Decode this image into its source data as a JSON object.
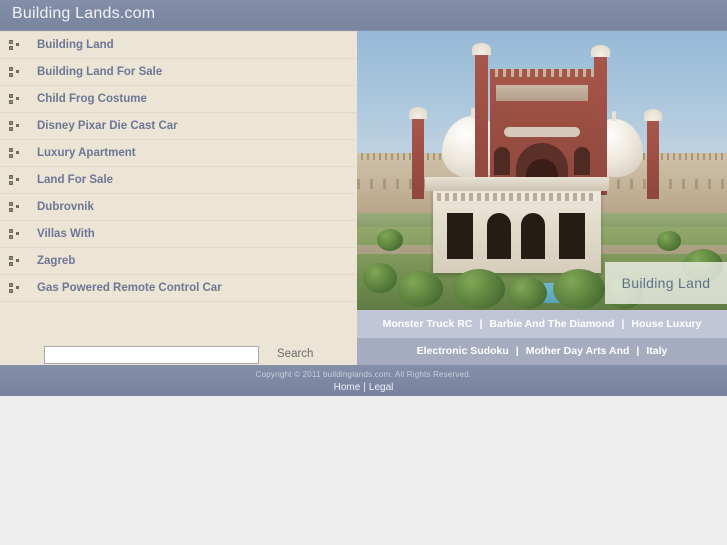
{
  "site": {
    "header_title": "Building Lands.com"
  },
  "keyword_list": [
    {
      "label": "Building Land",
      "icon": "bullet-list-icon"
    },
    {
      "label": "Building Land For Sale",
      "icon": "bullet-list-icon"
    },
    {
      "label": "Child Frog Costume",
      "icon": "bullet-list-icon"
    },
    {
      "label": "Disney Pixar Die Cast Car",
      "icon": "bullet-list-icon"
    },
    {
      "label": "Luxury Apartment",
      "icon": "bullet-list-icon"
    },
    {
      "label": "Land For Sale",
      "icon": "bullet-list-icon"
    },
    {
      "label": "Dubrovnik",
      "icon": "bullet-list-icon"
    },
    {
      "label": "Villas With",
      "icon": "bullet-list-icon"
    },
    {
      "label": "Zagreb",
      "icon": "bullet-list-icon"
    },
    {
      "label": "Gas Powered Remote Control Car",
      "icon": "bullet-list-icon"
    }
  ],
  "search": {
    "value": "",
    "placeholder": "",
    "button_label": "Search"
  },
  "photo": {
    "caption": "Building Land",
    "alt": "Badshahi Mosque building and gardens"
  },
  "link_rows": [
    {
      "links": [
        "Monster Truck RC",
        "Barbie And The Diamond",
        "House Luxury"
      ],
      "separator": "|"
    },
    {
      "links": [
        "Electronic Sudoku",
        "Mother Day Arts And",
        "Italy"
      ],
      "separator": "|"
    }
  ],
  "footer": {
    "copyright": "Copyright © 2011 buildinglands.com. All Rights Reserved.",
    "links": [
      "Home",
      "Legal"
    ],
    "separator": "|"
  },
  "colors": {
    "header_bg": "#7d88a3",
    "list_bg": "#ece5d5",
    "link_text": "#6d7695",
    "linkrow_light": "#c0c6d5",
    "linkrow_dark": "#a5acc0",
    "page_bg": "#eeeeee"
  }
}
